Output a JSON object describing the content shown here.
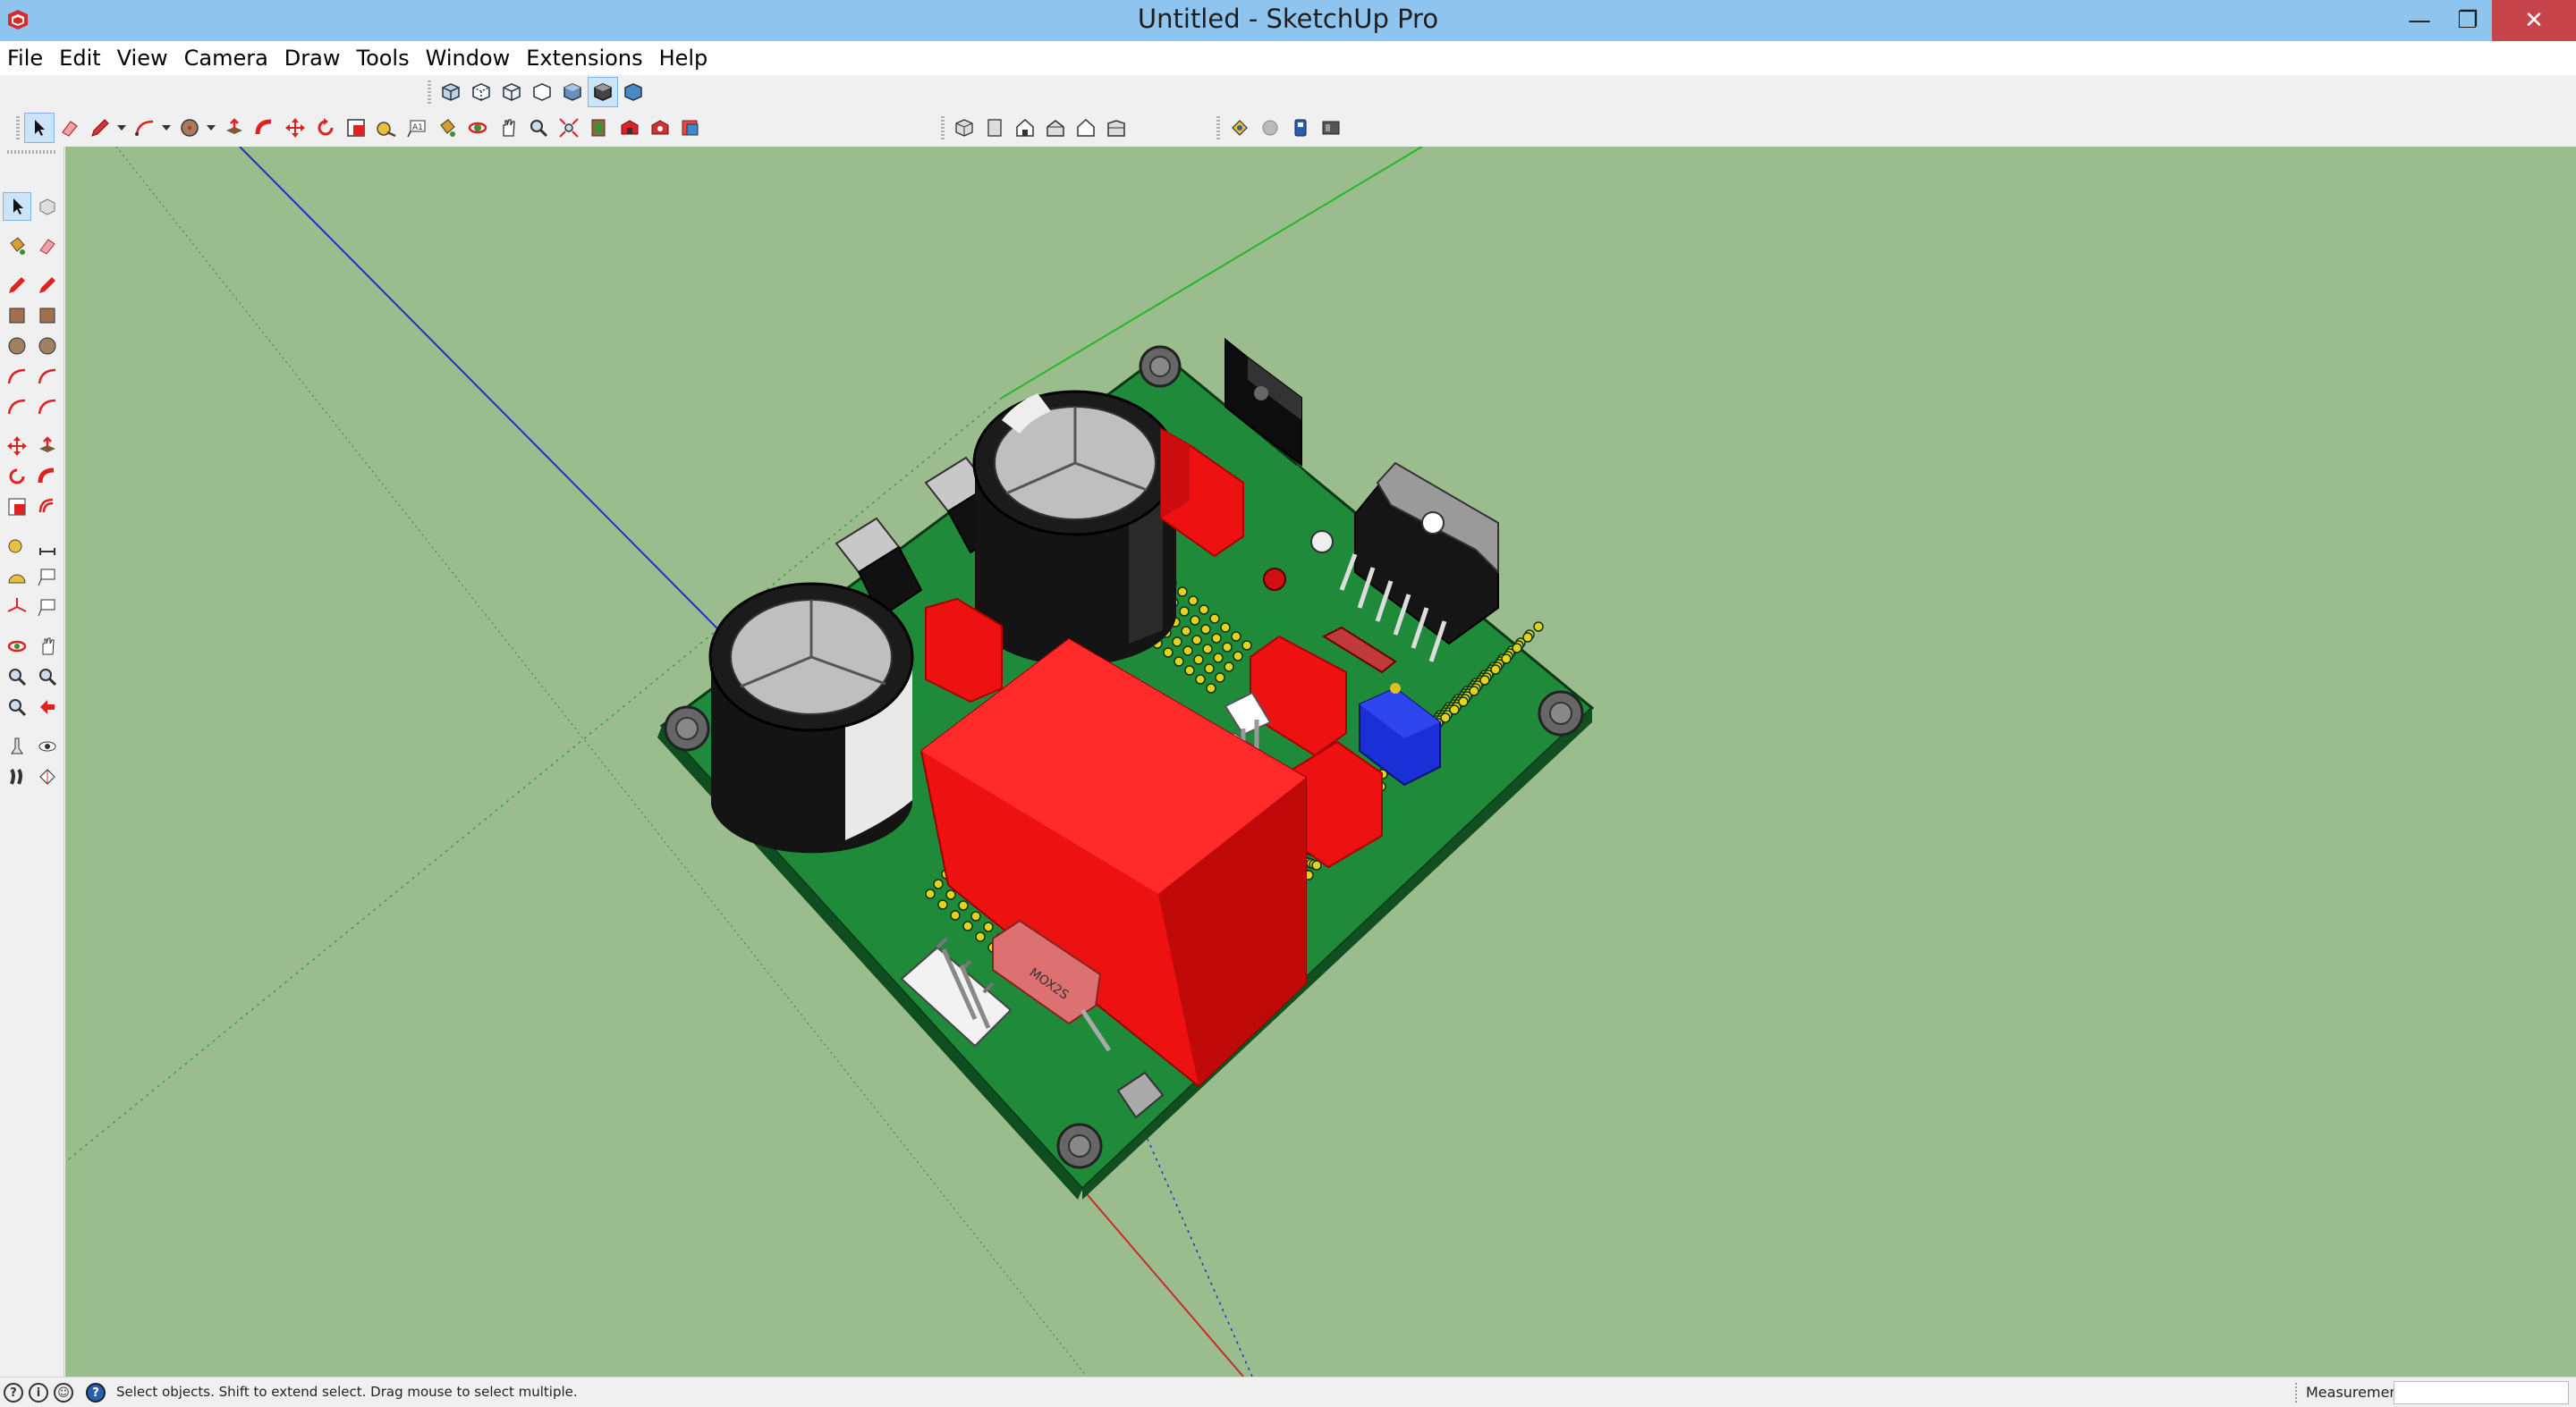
{
  "window": {
    "title": "Untitled - SketchUp Pro",
    "controls": {
      "minimize": "—",
      "maximize": "❐",
      "close": "✕"
    }
  },
  "menu": [
    "File",
    "Edit",
    "View",
    "Camera",
    "Draw",
    "Tools",
    "Window",
    "Extensions",
    "Help"
  ],
  "toolbars": {
    "styles": [
      "xray-icon",
      "back-edges-icon",
      "wireframe-icon",
      "hidden-line-icon",
      "shaded-icon",
      "shaded-textures-icon",
      "monochrome-icon"
    ],
    "active_style": "shaded-textures-icon",
    "main": [
      "select-icon",
      "eraser-icon",
      "pencil-icon",
      "arc-icon",
      "circle-icon",
      "push-pull-icon",
      "follow-me-icon",
      "move-icon",
      "rotate-icon",
      "scale-icon",
      "tape-measure-icon",
      "text-icon",
      "paint-bucket-icon",
      "orbit-icon",
      "pan-icon",
      "zoom-icon",
      "zoom-extents-icon",
      "component-icon",
      "warehouse-icon",
      "extension-warehouse-icon",
      "layout-icon"
    ],
    "views": [
      "iso-view-icon",
      "top-view-icon",
      "front-view-icon",
      "right-view-icon",
      "back-view-icon",
      "left-view-icon"
    ],
    "extras": [
      "section-plane-icon",
      "display-section-icon",
      "ruby-console-icon",
      "model-info-icon"
    ]
  },
  "palette": [
    "select-icon",
    "make-component-icon",
    "paint-bucket-icon",
    "eraser-icon",
    "line-icon",
    "freehand-icon",
    "rectangle-icon",
    "rotated-rectangle-icon",
    "circle-icon",
    "polygon-icon",
    "arc-icon",
    "two-point-arc-icon",
    "three-point-arc-icon",
    "pie-icon",
    "move-icon",
    "push-pull-icon",
    "rotate-icon",
    "follow-me-icon",
    "scale-icon",
    "offset-icon",
    "tape-measure-icon",
    "dimension-icon",
    "protractor-icon",
    "text-icon",
    "axes-icon",
    "3d-text-icon",
    "orbit-icon",
    "pan-icon",
    "zoom-icon",
    "zoom-window-icon",
    "zoom-extents-icon",
    "previous-view-icon",
    "position-camera-icon",
    "look-around-icon",
    "walk-icon",
    "section-icon"
  ],
  "status": {
    "text": "Select objects. Shift to extend select. Drag mouse to select multiple.",
    "measurements_label": "Measurements",
    "measurements_value": ""
  },
  "resistor_label": "MOX2S",
  "colors": {
    "titlebar": "#8fc4ee",
    "viewport": "#9bbd8e",
    "pcb": "#1f8a3a",
    "component_red": "#ee1111",
    "capacitor": "#1a1a1a",
    "potentiometer": "#1a2fd6"
  }
}
